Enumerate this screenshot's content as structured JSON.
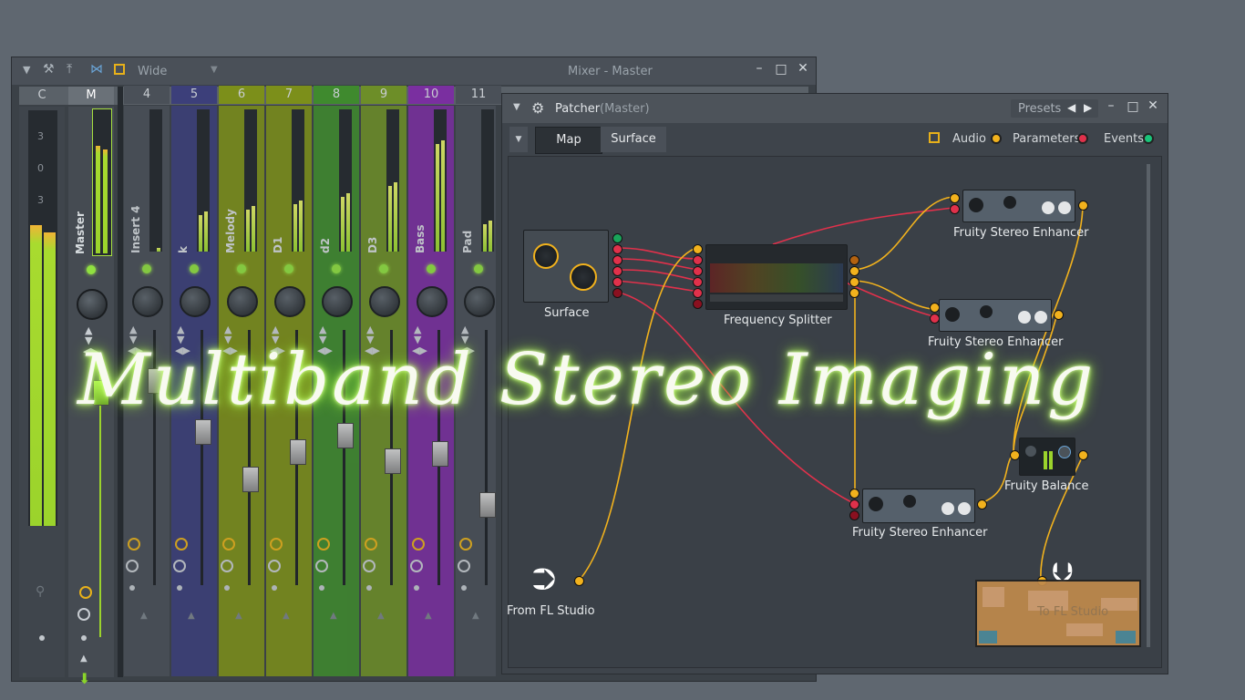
{
  "mixer": {
    "title": "Mixer - Master",
    "view_mode": "Wide",
    "tracks": [
      {
        "num": "C",
        "name": "",
        "color": "#4a5058"
      },
      {
        "num": "M",
        "name": "Master",
        "color": "#4a5058"
      },
      {
        "num": "4",
        "name": "Insert 4",
        "color": "#4a5058"
      },
      {
        "num": "5",
        "name": "k",
        "color": "#3c3f7a"
      },
      {
        "num": "6",
        "name": "Melody",
        "color": "#7c8f1a"
      },
      {
        "num": "7",
        "name": "D1",
        "color": "#7c8f1a"
      },
      {
        "num": "8",
        "name": "d2",
        "color": "#3f8a2e"
      },
      {
        "num": "9",
        "name": "D3",
        "color": "#6d8e28"
      },
      {
        "num": "10",
        "name": "Bass",
        "color": "#7a2fa0"
      },
      {
        "num": "11",
        "name": "Pad",
        "color": "#4a5058"
      }
    ],
    "peak_labels": [
      "3",
      "0",
      "3"
    ]
  },
  "patcher": {
    "title": "Patcher",
    "subtitle": "(Master)",
    "presets_label": "Presets",
    "tabs": [
      "Map",
      "Surface"
    ],
    "legend": [
      {
        "label": "Audio",
        "color": "#f2b21d"
      },
      {
        "label": "Parameters",
        "color": "#e0314b"
      },
      {
        "label": "Events",
        "color": "#19c47a"
      }
    ],
    "nodes": {
      "surface": "Surface",
      "frequency_splitter": "Frequency Splitter",
      "enhancer_1": "Fruity Stereo Enhancer",
      "enhancer_2": "Fruity Stereo Enhancer",
      "enhancer_3": "Fruity Stereo Enhancer",
      "balance": "Fruity Balance",
      "from_fl": "From FL Studio",
      "to_fl": "To FL Studio"
    }
  },
  "overlay": {
    "title": "Multiband Stereo Imaging"
  }
}
